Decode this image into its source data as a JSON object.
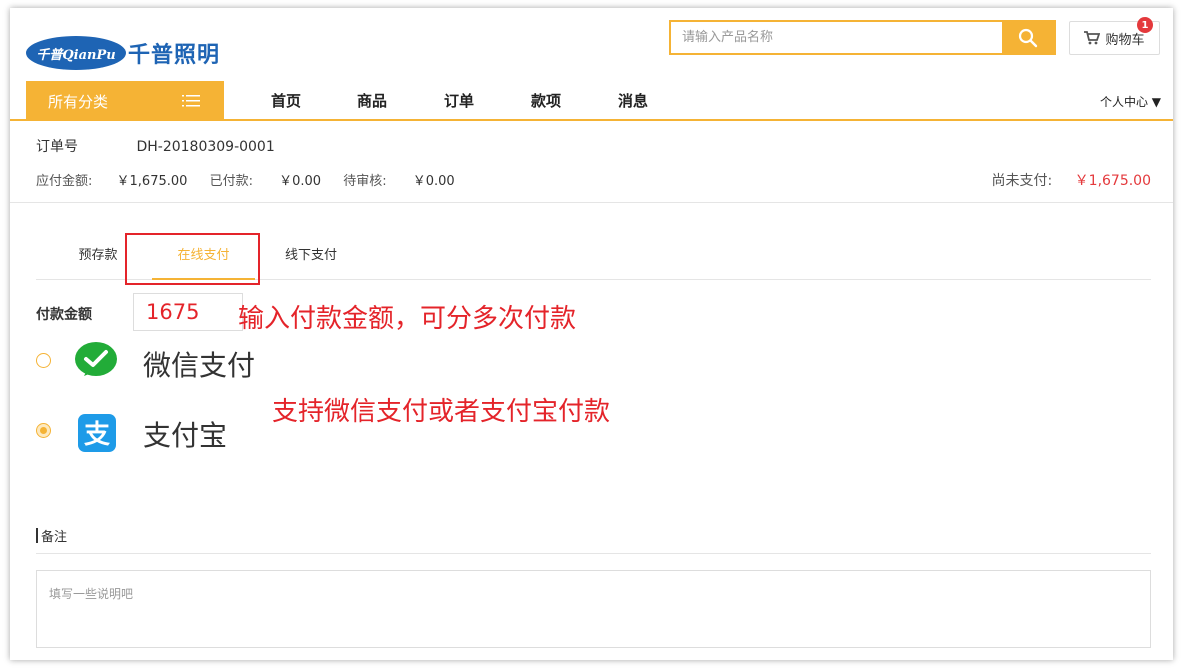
{
  "brand": {
    "logo_latin": "千普QianPu",
    "logo_cn": "千普照明",
    "brand_color": "#1e64b4"
  },
  "search": {
    "placeholder": "请输入产品名称",
    "button_icon": "search-icon"
  },
  "cart": {
    "label": "购物车",
    "badge": "1",
    "icon": "cart-icon"
  },
  "nav": {
    "category_label": "所有分类",
    "items": [
      {
        "label": "首页"
      },
      {
        "label": "商品"
      },
      {
        "label": "订单"
      },
      {
        "label": "款项"
      },
      {
        "label": "消息"
      }
    ],
    "personal": "个人中心 ▼",
    "accent": "#f5b335"
  },
  "order": {
    "number_label": "订单号",
    "number": "DH-20180309-0001",
    "payable_label": "应付金额:",
    "payable": "￥1,675.00",
    "paid_label": "已付款:",
    "paid": "￥0.00",
    "pending_label": "待审核:",
    "pending": "￥0.00",
    "unpaid_label": "尚未支付:",
    "unpaid": "￥1,675.00"
  },
  "tabs": [
    {
      "label": "预存款",
      "active": false
    },
    {
      "label": "在线支付",
      "active": true
    },
    {
      "label": "线下支付",
      "active": false
    }
  ],
  "payment": {
    "amount_label": "付款金额",
    "amount_value": "1675",
    "annotation_amount": "输入付款金额，可分多次付款",
    "annotation_methods": "支持微信支付或者支付宝付款",
    "methods": [
      {
        "label": "微信支付",
        "icon": "wechat-pay-icon",
        "selected": false,
        "color": "#22ac38"
      },
      {
        "label": "支付宝",
        "icon": "alipay-icon",
        "selected": true,
        "color": "#1e9be8"
      }
    ]
  },
  "remarks": {
    "title": "备注",
    "placeholder": "填写一些说明吧"
  }
}
